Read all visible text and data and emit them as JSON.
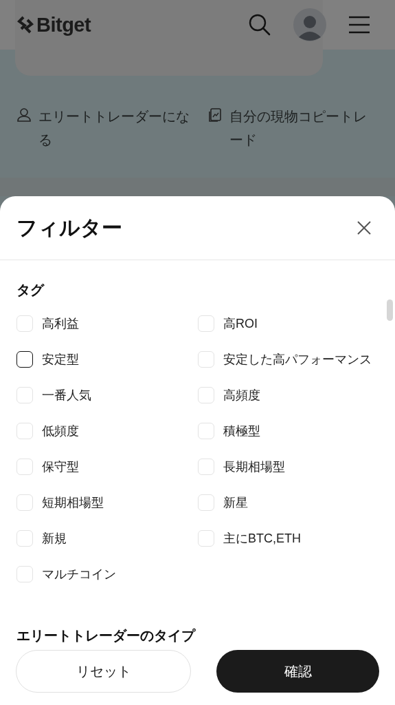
{
  "header": {
    "logo": "Bitget"
  },
  "background_links": [
    {
      "label": "エリートトレーダーになる"
    },
    {
      "label": "自分の現物コピートレード"
    }
  ],
  "filter_sheet": {
    "title": "フィルター",
    "tag_section": {
      "heading": "タグ",
      "tags": [
        {
          "label": "高利益",
          "checked": false,
          "focused": false
        },
        {
          "label": "高ROI",
          "checked": false,
          "focused": false
        },
        {
          "label": "安定型",
          "checked": false,
          "focused": true
        },
        {
          "label": "安定した高パフォーマンス",
          "checked": false,
          "focused": false
        },
        {
          "label": "一番人気",
          "checked": false,
          "focused": false
        },
        {
          "label": "高頻度",
          "checked": false,
          "focused": false
        },
        {
          "label": "低頻度",
          "checked": false,
          "focused": false
        },
        {
          "label": "積極型",
          "checked": false,
          "focused": false
        },
        {
          "label": "保守型",
          "checked": false,
          "focused": false
        },
        {
          "label": "長期相場型",
          "checked": false,
          "focused": false
        },
        {
          "label": "短期相場型",
          "checked": false,
          "focused": false
        },
        {
          "label": "新星",
          "checked": false,
          "focused": false
        },
        {
          "label": "新規",
          "checked": false,
          "focused": false
        },
        {
          "label": "主にBTC,ETH",
          "checked": false,
          "focused": false
        },
        {
          "label": "マルチコイン",
          "checked": false,
          "focused": false
        }
      ]
    },
    "next_section": {
      "heading": "エリートトレーダーのタイプ"
    },
    "buttons": [
      {
        "label": "リセット",
        "kind": "secondary"
      },
      {
        "label": "確認",
        "kind": "primary"
      }
    ]
  }
}
